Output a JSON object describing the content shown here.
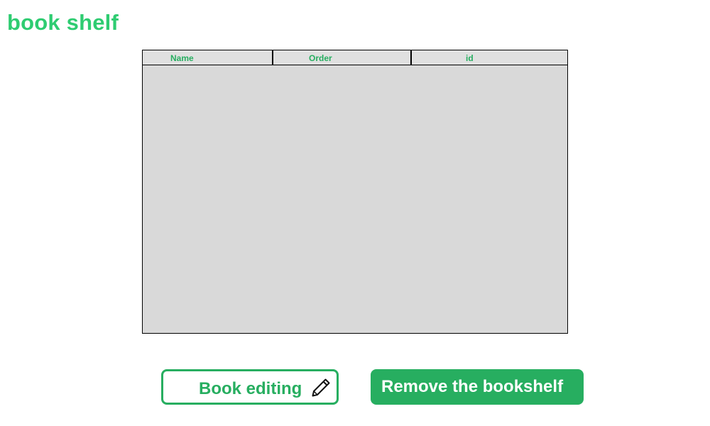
{
  "page": {
    "title": "book shelf"
  },
  "table": {
    "columns": [
      "Name",
      "Order",
      "id"
    ],
    "rows": []
  },
  "actions": {
    "edit_label": "Book editing",
    "edit_icon": "pencil-icon",
    "remove_label": "Remove the bookshelf"
  },
  "colors": {
    "accent": "#27ae60",
    "title": "#2ecc71",
    "table_background": "#d9d9d9"
  }
}
